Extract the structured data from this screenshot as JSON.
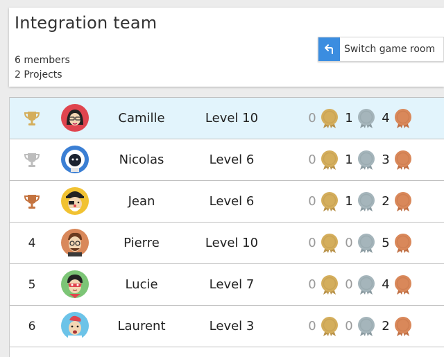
{
  "team": {
    "title": "Integration team",
    "members": "6 members",
    "projects": "2 Projects",
    "switch_label": "Switch game room",
    "switch_icon": "undo-arrow-icon"
  },
  "colors": {
    "gold": "#d4ae5c",
    "silver": "#a5b5bb",
    "bronze": "#d9885a",
    "highlight": "#e2f4fc",
    "accent": "#3b8de0"
  },
  "players": [
    {
      "rank": "",
      "trophy": "gold",
      "name": "Camille",
      "level": "Level 10",
      "gold": "0",
      "silver": "1",
      "bronze": "4",
      "highlight": true
    },
    {
      "rank": "",
      "trophy": "silver",
      "name": "Nicolas",
      "level": "Level 6",
      "gold": "0",
      "silver": "1",
      "bronze": "3",
      "highlight": false
    },
    {
      "rank": "",
      "trophy": "bronze",
      "name": "Jean",
      "level": "Level 6",
      "gold": "0",
      "silver": "1",
      "bronze": "2",
      "highlight": false
    },
    {
      "rank": "4",
      "trophy": "",
      "name": "Pierre",
      "level": "Level 10",
      "gold": "0",
      "silver": "0",
      "bronze": "5",
      "highlight": false
    },
    {
      "rank": "5",
      "trophy": "",
      "name": "Lucie",
      "level": "Level 7",
      "gold": "0",
      "silver": "0",
      "bronze": "4",
      "highlight": false
    },
    {
      "rank": "6",
      "trophy": "",
      "name": "Laurent",
      "level": "Level 3",
      "gold": "0",
      "silver": "0",
      "bronze": "2",
      "highlight": false
    }
  ]
}
